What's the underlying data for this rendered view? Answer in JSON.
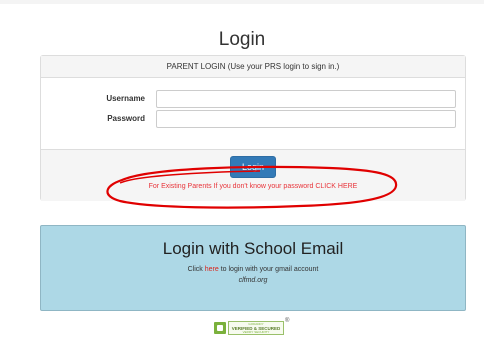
{
  "page": {
    "title": "Login"
  },
  "login_panel": {
    "heading": "PARENT LOGIN (Use your PRS login to sign in.)",
    "username_label": "Username",
    "username_value": "",
    "password_label": "Password",
    "password_value": "",
    "login_button": "Login",
    "forgot_link": "For Existing Parents If you don't know your password CLICK HERE"
  },
  "school_login": {
    "title": "Login with School Email",
    "text_prefix": "Click ",
    "link_text": "here",
    "text_suffix": " to login with your gmail account",
    "domain": "clfmd.org"
  },
  "seal": {
    "line1": "GODADDY",
    "line2": "VERIFIED & SECURED",
    "line3": "VERIFY SECURITY",
    "reg": "®"
  },
  "colors": {
    "accent_button": "#337ab7",
    "link_red": "#e8343a",
    "school_box_bg": "#add8e6",
    "annotation_red": "#e00000"
  }
}
